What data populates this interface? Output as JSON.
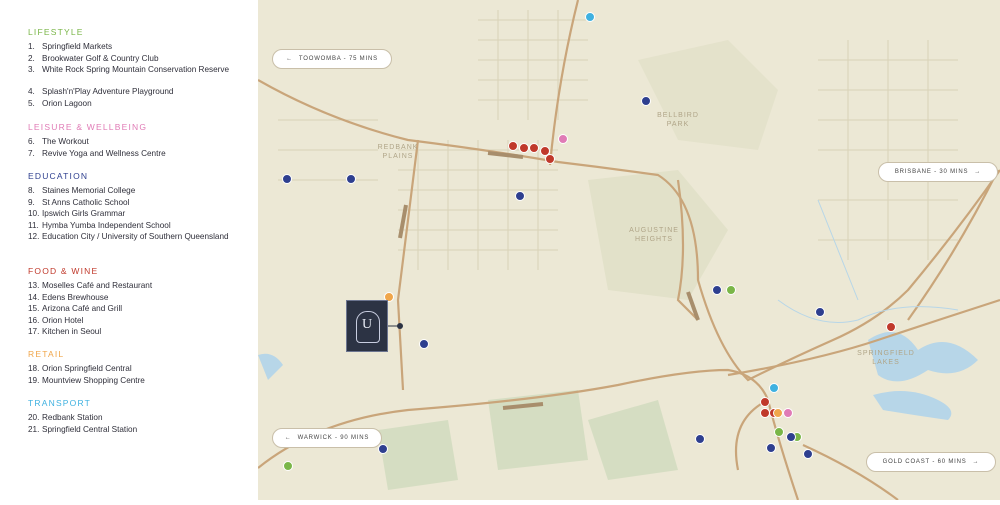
{
  "colors": {
    "lifestyle": "#7ab648",
    "leisure": "#e07bb6",
    "education": "#2e3f8f",
    "food": "#c0392b",
    "retail": "#f0a64a",
    "transport": "#3fb1e0",
    "land": "#ece8d5",
    "road": "#c9a57a",
    "water": "#b7d6e8",
    "park": "#d5ddc2"
  },
  "legend": {
    "categories": [
      {
        "title": "LIFESTYLE",
        "color": "#7ab648",
        "items": [
          {
            "num": "1.",
            "label": "Springfield Markets"
          },
          {
            "num": "2.",
            "label": "Brookwater Golf & Country Club"
          },
          {
            "num": "3.",
            "label": "White Rock Spring Mountain Conservation Reserve"
          },
          {
            "num": "4.",
            "label": "Splash'n'Play Adventure Playground"
          },
          {
            "num": "5.",
            "label": "Orion Lagoon"
          }
        ]
      },
      {
        "title": "LEISURE & WELLBEING",
        "color": "#e07bb6",
        "items": [
          {
            "num": "6.",
            "label": "The Workout"
          },
          {
            "num": "7.",
            "label": "Revive Yoga and Wellness Centre"
          }
        ]
      },
      {
        "title": "EDUCATION",
        "color": "#2e3f8f",
        "items": [
          {
            "num": "8.",
            "label": "Staines Memorial College"
          },
          {
            "num": "9.",
            "label": "St Anns Catholic School"
          },
          {
            "num": "10.",
            "label": "Ipswich Girls Grammar"
          },
          {
            "num": "11.",
            "label": "Hymba Yumba Independent School"
          },
          {
            "num": "12.",
            "label": "Education City / University of Southern Queensland"
          }
        ]
      },
      {
        "title": "FOOD & WINE",
        "color": "#c0392b",
        "items": [
          {
            "num": "13.",
            "label": "Moselles Café and Restaurant"
          },
          {
            "num": "14.",
            "label": "Edens Brewhouse"
          },
          {
            "num": "15.",
            "label": "Arizona Café and Grill"
          },
          {
            "num": "16.",
            "label": "Orion Hotel"
          },
          {
            "num": "17.",
            "label": "Kitchen in Seoul"
          }
        ]
      },
      {
        "title": "RETAIL",
        "color": "#f0a64a",
        "items": [
          {
            "num": "18.",
            "label": "Orion Springfield Central"
          },
          {
            "num": "19.",
            "label": "Mountview Shopping Centre"
          }
        ]
      },
      {
        "title": "TRANSPORT",
        "color": "#3fb1e0",
        "items": [
          {
            "num": "20.",
            "label": "Redbank Station"
          },
          {
            "num": "21.",
            "label": "Springfield Central Station"
          }
        ]
      }
    ]
  },
  "map": {
    "place_labels": [
      "REDBANK PLAINS",
      "BELLBIRD PARK",
      "AUGUSTINE HEIGHTS",
      "SPRINGFIELD LAKES"
    ],
    "direction_pills": [
      {
        "text": "TOOWOMBA - 75 MINS",
        "arrow": "←"
      },
      {
        "text": "BRISBANE - 30 MINS",
        "arrow": "→"
      },
      {
        "text": "WARWICK - 90 MINS",
        "arrow": "←"
      },
      {
        "text": "GOLD COAST - 60 MINS",
        "arrow": "→"
      }
    ],
    "site_logo_letter": "U"
  }
}
